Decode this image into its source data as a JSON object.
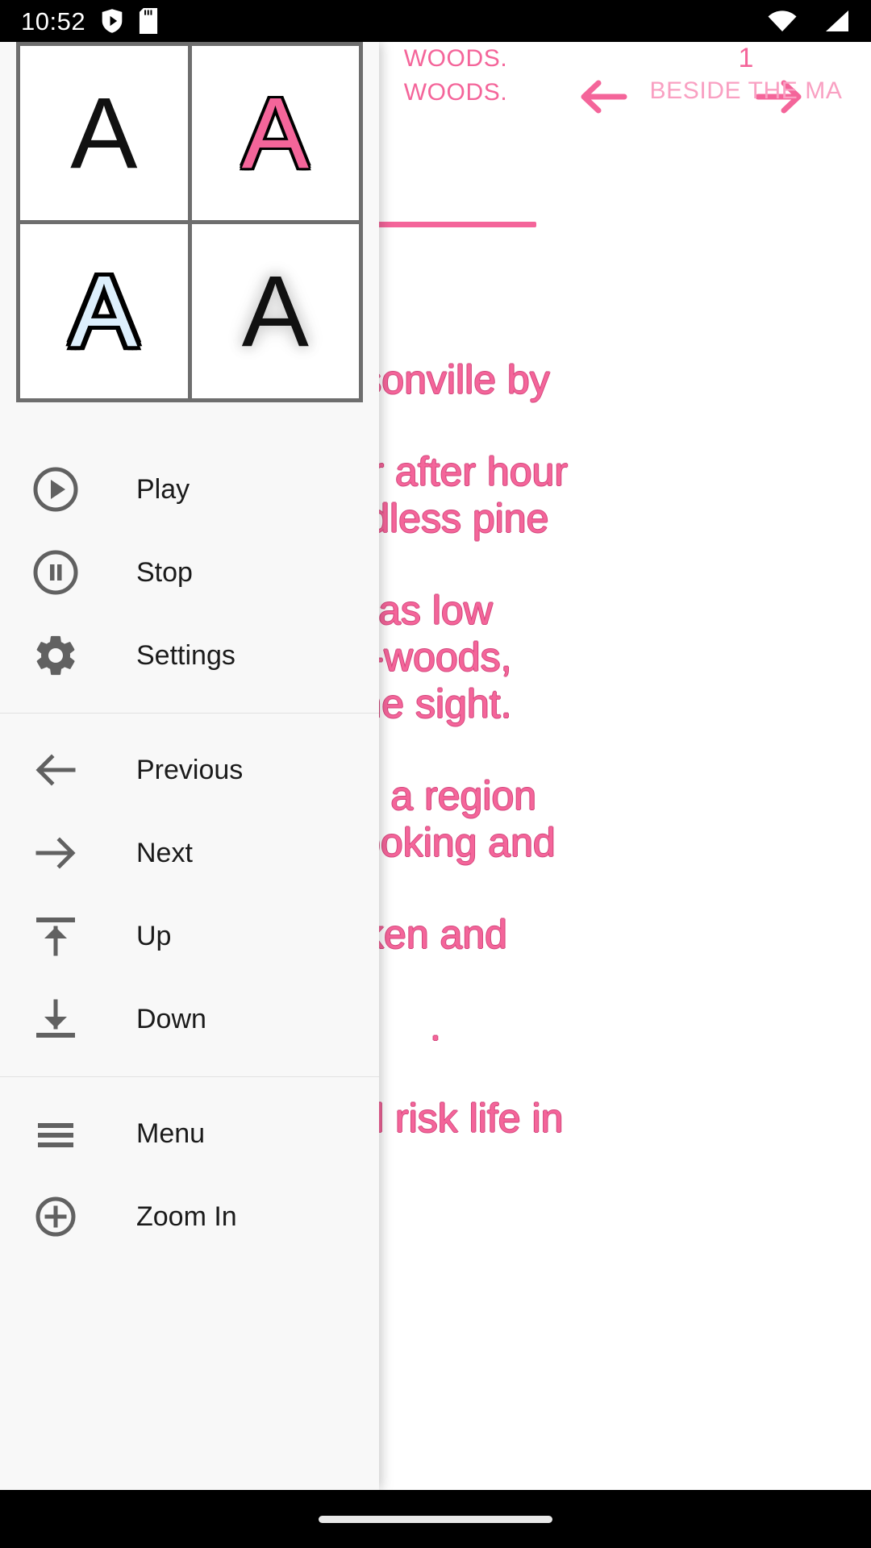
{
  "status_bar": {
    "clock": "10:52",
    "left_icons": [
      "play-protect-icon",
      "sd-card-icon"
    ],
    "right_icons": [
      "wifi-icon",
      "cellular-signal-icon"
    ]
  },
  "reader": {
    "nav": {
      "prev_arrow": "arrow-left-icon",
      "next_arrow": "arrow-right-icon"
    },
    "tabs": [
      {
        "number": "",
        "title_top": "WOODS.",
        "title_bottom": "WOODS.",
        "selected": true
      },
      {
        "number": "1",
        "title_top": "",
        "title_bottom": "BESIDE THE MA",
        "selected": false
      }
    ],
    "paragraphs": [
      {
        "lines": [
          "cksonville by"
        ]
      },
      {
        "lines": [
          "hour after hour",
          "endless pine"
        ]
      },
      {
        "lines": [
          "as low",
          "t-woods,",
          "ne sight."
        ]
      },
      {
        "lines": [
          "ne a region",
          "e looking and"
        ]
      },
      {
        "lines": [
          "ken and"
        ]
      },
      {
        "lines": [
          "."
        ]
      },
      {
        "lines": [
          "ould risk life in"
        ]
      }
    ],
    "accent_color": "#f4659a",
    "accent_dim_color": "#f9a0c2"
  },
  "drawer": {
    "style_grid": {
      "label": "text-style-presets",
      "cells": [
        {
          "glyph": "A",
          "style": "plain",
          "name": "style-plain"
        },
        {
          "glyph": "A",
          "style": "pink-outline",
          "name": "style-pink-outline"
        },
        {
          "glyph": "A",
          "style": "blue-thick-outline",
          "name": "style-blue-outline"
        },
        {
          "glyph": "A",
          "style": "black-glow",
          "name": "style-black-glow"
        }
      ],
      "border_color": "#6e6e6e"
    },
    "groups": [
      {
        "items": [
          {
            "label": "Play",
            "icon": "play-circle-icon"
          },
          {
            "label": "Stop",
            "icon": "pause-circle-icon"
          },
          {
            "label": "Settings",
            "icon": "gear-icon"
          }
        ]
      },
      {
        "items": [
          {
            "label": "Previous",
            "icon": "arrow-left-icon"
          },
          {
            "label": "Next",
            "icon": "arrow-right-icon"
          },
          {
            "label": "Up",
            "icon": "arrow-up-to-line-icon"
          },
          {
            "label": "Down",
            "icon": "arrow-down-to-line-icon"
          }
        ]
      },
      {
        "items": [
          {
            "label": "Menu",
            "icon": "hamburger-menu-icon"
          },
          {
            "label": "Zoom In",
            "icon": "zoom-in-circle-icon"
          }
        ]
      }
    ]
  },
  "nav_bar": {
    "handle": "home-gesture-handle"
  }
}
